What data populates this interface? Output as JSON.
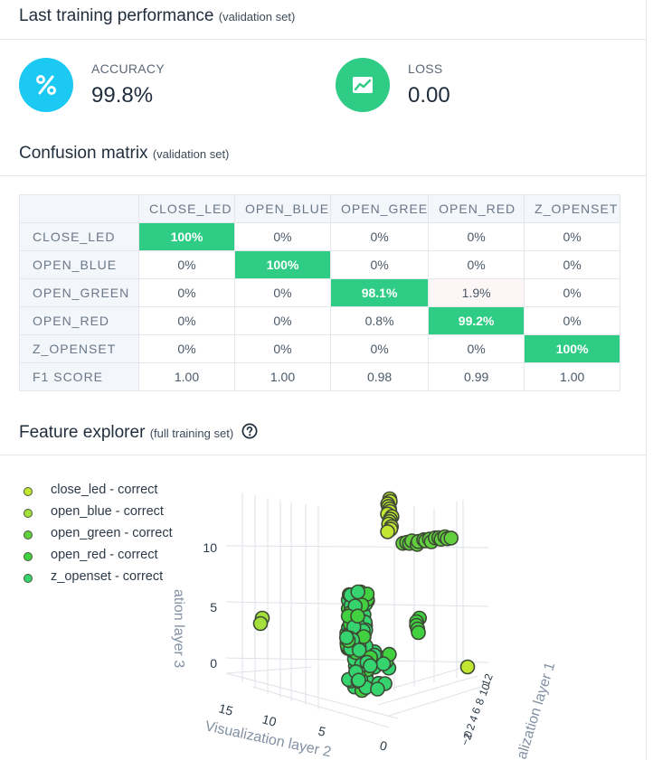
{
  "performance": {
    "title": "Last training performance",
    "subtitle": "(validation set)",
    "accuracy": {
      "label": "ACCURACY",
      "value": "99.8%",
      "icon": "percent-icon",
      "color": "#1bc9f3"
    },
    "loss": {
      "label": "LOSS",
      "value": "0.00",
      "icon": "line-chart-icon",
      "color": "#2fcc85"
    }
  },
  "confusion": {
    "title": "Confusion matrix",
    "subtitle": "(validation set)",
    "columns": [
      "CLOSE_LED",
      "OPEN_BLUE",
      "OPEN_GREE",
      "OPEN_RED",
      "Z_OPENSET"
    ],
    "rows": [
      {
        "label": "CLOSE_LED",
        "cells": [
          "100%",
          "0%",
          "0%",
          "0%",
          "0%"
        ]
      },
      {
        "label": "OPEN_BLUE",
        "cells": [
          "0%",
          "100%",
          "0%",
          "0%",
          "0%"
        ]
      },
      {
        "label": "OPEN_GREEN",
        "cells": [
          "0%",
          "0%",
          "98.1%",
          "1.9%",
          "0%"
        ]
      },
      {
        "label": "OPEN_RED",
        "cells": [
          "0%",
          "0%",
          "0.8%",
          "99.2%",
          "0%"
        ]
      },
      {
        "label": "Z_OPENSET",
        "cells": [
          "0%",
          "0%",
          "0%",
          "0%",
          "100%"
        ]
      }
    ],
    "f1": {
      "label": "F1 SCORE",
      "cells": [
        "1.00",
        "1.00",
        "0.98",
        "0.99",
        "1.00"
      ]
    },
    "highlight_color": "#2fcc85"
  },
  "explorer": {
    "title": "Feature explorer",
    "subtitle": "(full training set)",
    "legend": [
      {
        "label": "close_led - correct",
        "color": "#c3e632"
      },
      {
        "label": "open_blue - correct",
        "color": "#a4e03c"
      },
      {
        "label": "open_green - correct",
        "color": "#62cf3e"
      },
      {
        "label": "open_red - correct",
        "color": "#41d140"
      },
      {
        "label": "z_openset - correct",
        "color": "#36d46e"
      }
    ],
    "axes": {
      "z_title": "ation layer 3",
      "x_title": "Visualization layer 2",
      "y_title": "alization layer 1",
      "z_ticks": [
        "10",
        "5",
        "0"
      ],
      "x_ticks": [
        "15",
        "10",
        "5",
        "0"
      ],
      "y_ticks": [
        "12",
        "10",
        "8",
        "6",
        "4",
        "2",
        "0",
        "−2"
      ]
    }
  }
}
